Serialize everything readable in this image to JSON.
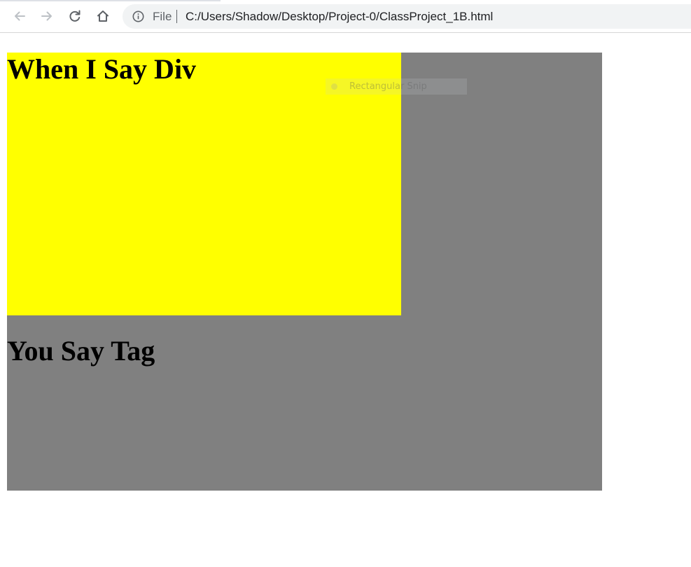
{
  "browser": {
    "scheme_label": "File",
    "url": "C:/Users/Shadow/Desktop/Project-0/ClassProject_1B.html",
    "icons": [
      "back-arrow-icon",
      "forward-arrow-icon",
      "reload-icon",
      "home-icon",
      "info-icon"
    ]
  },
  "page": {
    "heading_1": "When I Say Div",
    "heading_2": "You Say Tag",
    "colors": {
      "outer_box": "#808080",
      "inner_box": "#ffff00",
      "text": "#000000"
    }
  },
  "overlay": {
    "snip_label": "Rectangular Snip"
  }
}
